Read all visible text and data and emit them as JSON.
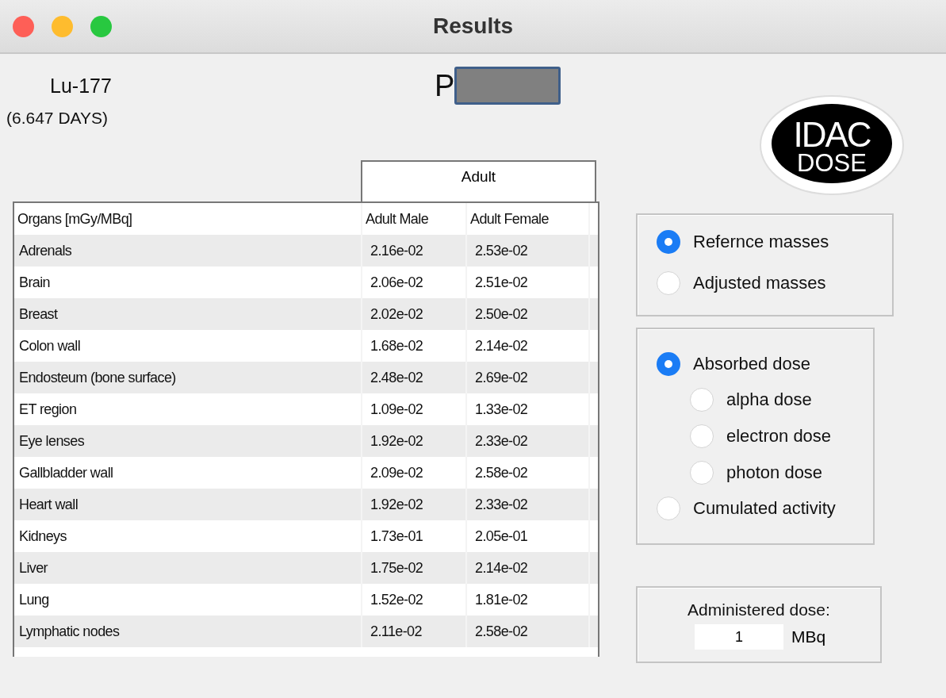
{
  "window": {
    "title": "Results"
  },
  "nuclide": {
    "name": "Lu-177",
    "half_life": "(6.647 DAYS)"
  },
  "phantom_label": "P",
  "logo": {
    "line_1": "IDAC",
    "line_2": "DOSE"
  },
  "table": {
    "group_header": "Adult",
    "columns": [
      "Organs [mGy/MBq]",
      "Adult Male",
      "Adult Female"
    ],
    "rows": [
      [
        "Adrenals",
        "2.16e-02",
        "2.53e-02"
      ],
      [
        "Brain",
        "2.06e-02",
        "2.51e-02"
      ],
      [
        "Breast",
        "2.02e-02",
        "2.50e-02"
      ],
      [
        "Colon wall",
        "1.68e-02",
        "2.14e-02"
      ],
      [
        "Endosteum (bone surface)",
        "2.48e-02",
        "2.69e-02"
      ],
      [
        "ET region",
        "1.09e-02",
        "1.33e-02"
      ],
      [
        "Eye lenses",
        "1.92e-02",
        "2.33e-02"
      ],
      [
        "Gallbladder wall",
        "2.09e-02",
        "2.58e-02"
      ],
      [
        "Heart wall",
        "1.92e-02",
        "2.33e-02"
      ],
      [
        "Kidneys",
        "1.73e-01",
        "2.05e-01"
      ],
      [
        "Liver",
        "1.75e-02",
        "2.14e-02"
      ],
      [
        "Lung",
        "1.52e-02",
        "1.81e-02"
      ],
      [
        "Lymphatic nodes",
        "2.11e-02",
        "2.58e-02"
      ]
    ]
  },
  "mass_options": [
    {
      "label": "Refernce masses",
      "selected": true
    },
    {
      "label": "Adjusted masses",
      "selected": false
    }
  ],
  "dose_options": [
    {
      "label": "Absorbed dose",
      "selected": true,
      "children": [
        {
          "label": "alpha dose",
          "selected": false
        },
        {
          "label": "electron dose",
          "selected": false
        },
        {
          "label": "photon dose",
          "selected": false
        }
      ]
    },
    {
      "label": "Cumulated activity",
      "selected": false
    }
  ],
  "administered_dose": {
    "label": "Administered dose:",
    "value": "1",
    "unit": "MBq"
  }
}
